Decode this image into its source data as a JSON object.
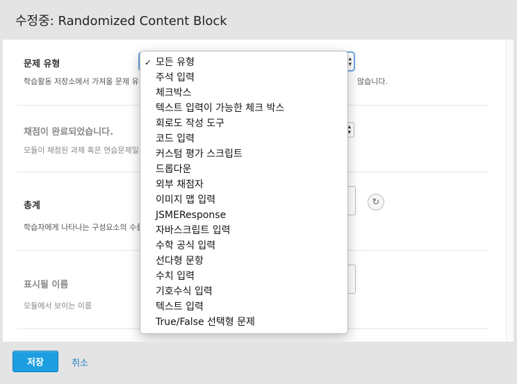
{
  "modal": {
    "title": "수정중: Randomized Content Block"
  },
  "fields": {
    "problem_type": {
      "label": "문제 유형",
      "help_prefix": "학습활동 저장소에서 가져올 문제 유",
      "help_suffix": "않습니다."
    },
    "graded": {
      "label": "채점이 완료되었습니다.",
      "help": "모듈이 채점된 과제 혹은 연습문제일"
    },
    "count": {
      "label": "총계",
      "help": "학습자에게 나타나는 구성요소의 수를"
    },
    "display_name": {
      "label": "표시될 이름",
      "help": "모듈에서 보이는 이름"
    }
  },
  "dropdown": {
    "selected": "모든 유형",
    "check_mark": "✓",
    "options": [
      "모든 유형",
      "주석 입력",
      "체크박스",
      "텍스트 입력이 가능한 체크 박스",
      "회로도 작성 도구",
      "코드 입력",
      "커스텀 평가 스크립트",
      "드롭다운",
      "외부 채점자",
      "이미지 맵 입력",
      "JSMEResponse",
      "자바스크립트 입력",
      "수학 공식 입력",
      "선다형 문항",
      "수치 입력",
      "기호수식 입력",
      "텍스트 입력",
      "True/False 선택형 문제"
    ]
  },
  "footer": {
    "save_label": "저장",
    "cancel_label": "취소"
  },
  "colors": {
    "primary": "#1d9ee0",
    "link": "#1d7fc4",
    "focus": "#6aa8e8"
  }
}
